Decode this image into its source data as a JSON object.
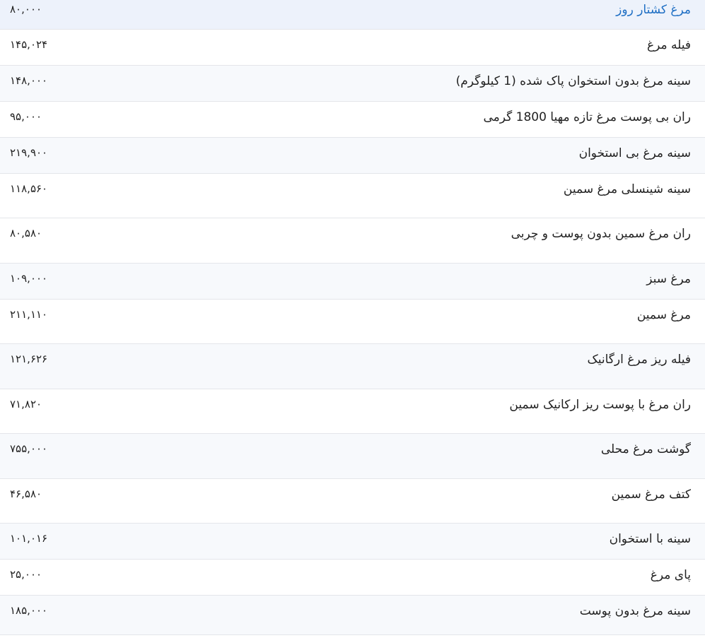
{
  "table": {
    "rows": [
      {
        "name": "مرغ کشتار روز",
        "price": "۸۰,۰۰۰",
        "link": true
      },
      {
        "name": "فیله مرغ",
        "price": "۱۴۵,۰۲۴"
      },
      {
        "name": "سینه مرغ بدون استخوان پاک شده (1 کیلوگرم)",
        "price": "۱۴۸,۰۰۰"
      },
      {
        "name": "ران بی پوست مرغ تازه مهیا 1800 گرمی",
        "price": "۹۵,۰۰۰"
      },
      {
        "name": "سینه مرغ بی استخوان",
        "price": "۲۱۹,۹۰۰"
      },
      {
        "name": "سینه شینسلی مرغ سمین",
        "price": "۱۱۸,۵۶۰"
      },
      {
        "name": "ران مرغ سمین بدون پوست و چربی",
        "price": "۸۰,۵۸۰"
      },
      {
        "name": "مرغ سبز",
        "price": "۱۰۹,۰۰۰"
      },
      {
        "name": "مرغ سمین",
        "price": "۲۱۱,۱۱۰"
      },
      {
        "name": "فیله ریز مرغ ارگانیک",
        "price": "۱۲۱,۶۲۶"
      },
      {
        "name": "ران مرغ با پوست ریز ارکانیک سمین",
        "price": "۷۱,۸۲۰"
      },
      {
        "name": "گوشت مرغ محلی",
        "price": "۷۵۵,۰۰۰"
      },
      {
        "name": "کتف مرغ سمین",
        "price": "۴۶,۵۸۰"
      },
      {
        "name": "سینه با استخوان",
        "price": "۱۰۱,۰۱۶"
      },
      {
        "name": "پای مرغ",
        "price": "۲۵,۰۰۰"
      },
      {
        "name": "سینه مرغ بدون پوست",
        "price": "۱۸۵,۰۰۰"
      }
    ]
  },
  "colors": {
    "link": "#1f6fc4",
    "text": "#222222",
    "row_alt": "#f7f9fc",
    "row_first": "#edf2fb",
    "border": "#e4e6ea"
  }
}
